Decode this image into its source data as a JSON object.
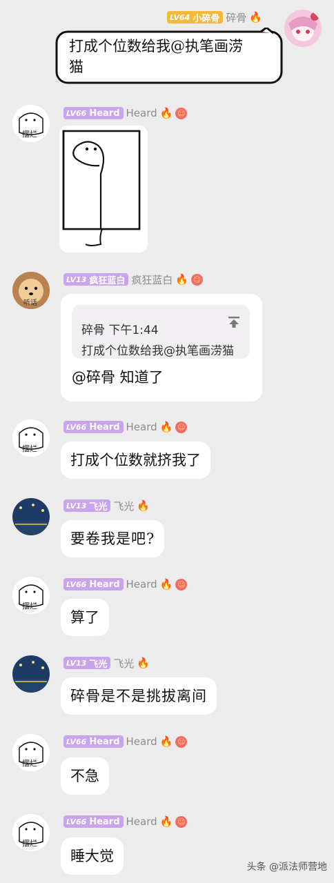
{
  "messages": [
    {
      "level": "LV64",
      "tag": "小碎骨",
      "name": "碎骨",
      "text_lines": [
        "打成个位数给我@执笔画涝",
        "猫"
      ]
    },
    {
      "level": "LV66",
      "tag": "Heard",
      "name": "Heard",
      "image": "drawn-dinosaur-sticker"
    },
    {
      "level": "LV13",
      "tag": "疯狂蓝白",
      "name": "疯狂蓝白",
      "quote_author": "碎骨",
      "quote_time": "下午1:44",
      "quote_text": "打成个位数给我@执笔画涝猫",
      "text": "@碎骨 知道了"
    },
    {
      "level": "LV66",
      "tag": "Heard",
      "name": "Heard",
      "text": "打成个位数就挤我了"
    },
    {
      "level": "LV13",
      "tag": "飞光",
      "name": "飞光",
      "text": "要卷我是吧?"
    },
    {
      "level": "LV66",
      "tag": "Heard",
      "name": "Heard",
      "text": "算了"
    },
    {
      "level": "LV13",
      "tag": "飞光",
      "name": "飞光",
      "text": "碎骨是不是挑拔离间"
    },
    {
      "level": "LV66",
      "tag": "Heard",
      "name": "Heard",
      "text": "不急"
    },
    {
      "level": "LV66",
      "tag": "Heard",
      "name": "Heard",
      "text": "睡大觉"
    }
  ],
  "avatars": {
    "heard_caption": "摆烂",
    "puppy_caption": "听话"
  },
  "icons": [
    "fire-icon",
    "smile-badge-icon",
    "pin-top-icon"
  ],
  "watermark": "头条 @派法师营地",
  "colors": {
    "background": "#ececec",
    "bubble": "#ffffff",
    "level_tag": "#c9a4ec",
    "owner_tag": "#f2b93b"
  }
}
